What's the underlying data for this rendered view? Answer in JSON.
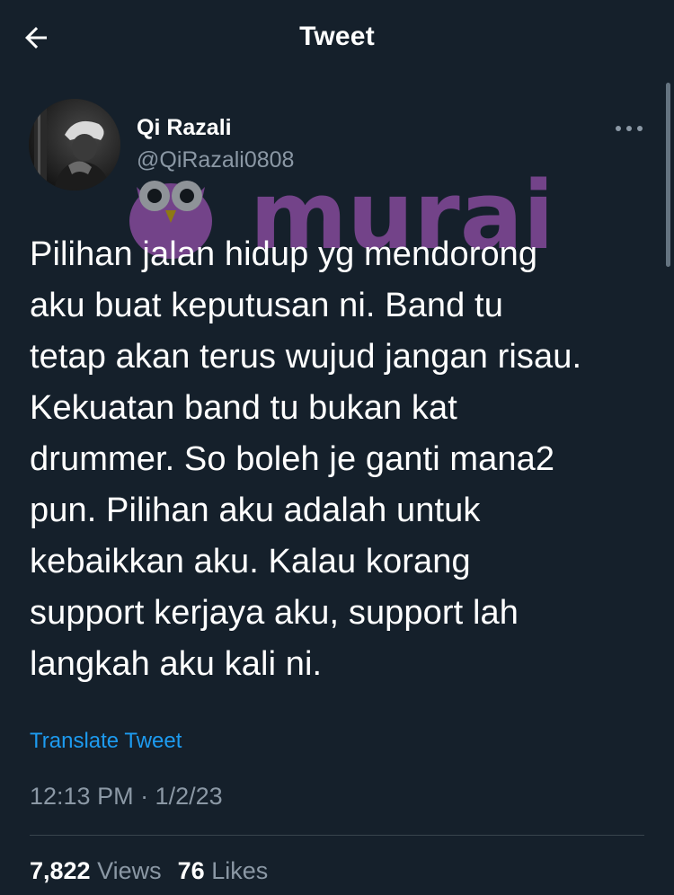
{
  "header": {
    "title": "Tweet",
    "back_icon": "arrow-left-icon"
  },
  "author": {
    "display_name": "Qi Razali",
    "handle": "@QiRazali0808",
    "more_icon": "more-horizontal-icon"
  },
  "watermark": {
    "text": "murai",
    "color": "#c061d6"
  },
  "tweet": {
    "text": "Pilihan jalan hidup yg mendorong\naku buat keputusan ni. Band tu\ntetap akan terus wujud jangan risau.\nKekuatan band tu bukan kat\ndrummer. So boleh je ganti mana2\npun. Pilihan aku adalah untuk\nkebaikkan aku. Kalau korang\nsupport kerjaya aku, support lah\nlangkah aku kali ni.",
    "translate_label": "Translate Tweet",
    "timestamp": "12:13 PM · 1/2/23"
  },
  "stats": {
    "views_count": "7,822",
    "views_label": "Views",
    "likes_count": "76",
    "likes_label": "Likes"
  },
  "colors": {
    "background": "#15202b",
    "text_primary": "#ffffff",
    "text_secondary": "#8b98a5",
    "link": "#1d9bf0",
    "divider": "#38444d"
  }
}
